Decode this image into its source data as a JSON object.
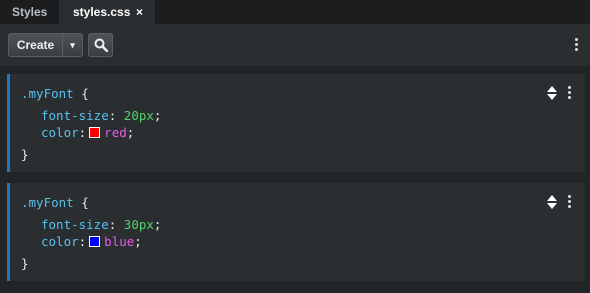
{
  "tabs": [
    {
      "label": "Styles",
      "active": false
    },
    {
      "label": "styles.css",
      "active": true,
      "close": "×"
    }
  ],
  "toolbar": {
    "create_label": "Create",
    "caret": "▾",
    "search_icon": "magnifier",
    "more_icon": "vertical-ellipsis"
  },
  "rules": [
    {
      "selector": ".myFont",
      "open": "{",
      "close": "}",
      "declarations": [
        {
          "property": "font-size",
          "value": "20px",
          "type": "number"
        },
        {
          "property": "color",
          "value": "red",
          "type": "color",
          "swatch": "#ff0000"
        }
      ]
    },
    {
      "selector": ".myFont",
      "open": "{",
      "close": "}",
      "declarations": [
        {
          "property": "font-size",
          "value": "30px",
          "type": "number"
        },
        {
          "property": "color",
          "value": "blue",
          "type": "color",
          "swatch": "#0000ff"
        }
      ]
    }
  ],
  "colors": {
    "accent": "#1f78c6",
    "selector": "#56c1ee",
    "number": "#52d36b",
    "keyword": "#e65ee6"
  }
}
